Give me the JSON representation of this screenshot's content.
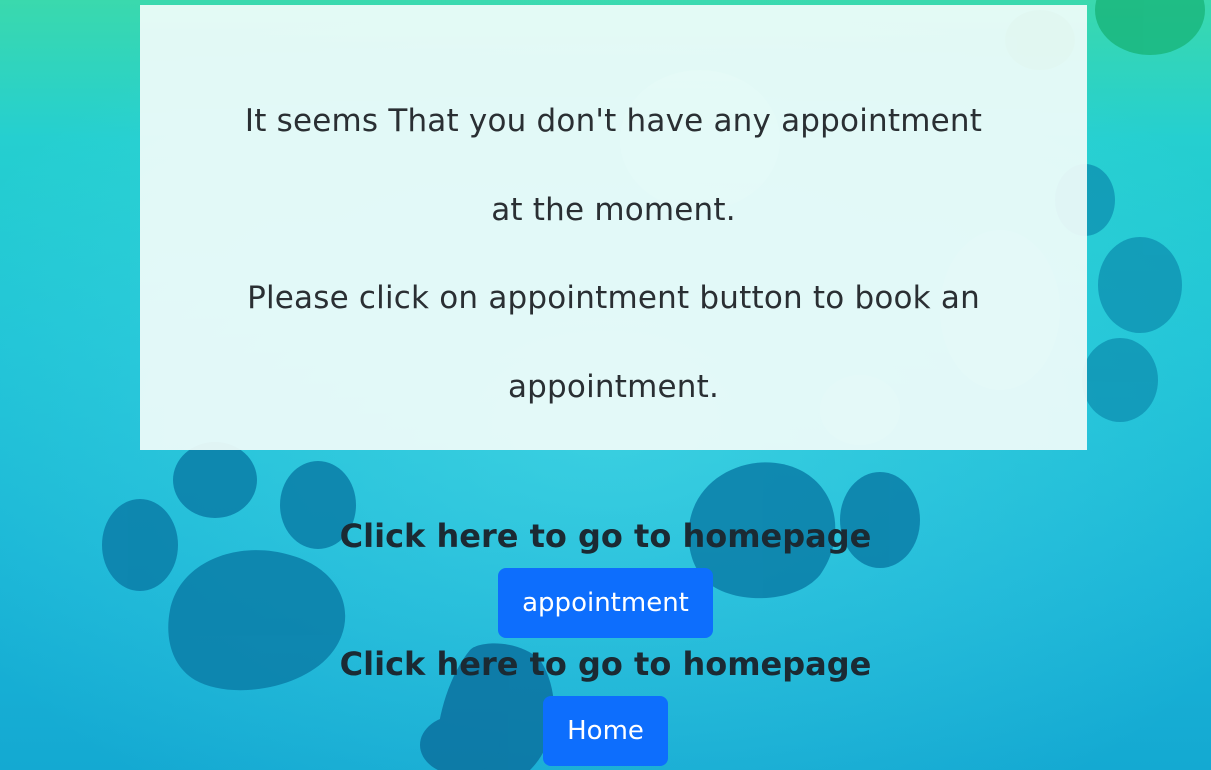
{
  "message": {
    "line1": "It seems That you don't have any appointment",
    "line2": "at the moment.",
    "line3": "Please click on appointment button to book an",
    "line4": "appointment."
  },
  "actions": {
    "first_heading": "Click here to go to homepage",
    "appointment_button": "appointment",
    "second_heading": "Click here to go to homepage",
    "home_button": "Home"
  },
  "colors": {
    "button_bg": "#0d6efd",
    "button_text": "#ffffff",
    "panel_bg": "#f0fcfa",
    "paw_color": "#0b6d99"
  }
}
